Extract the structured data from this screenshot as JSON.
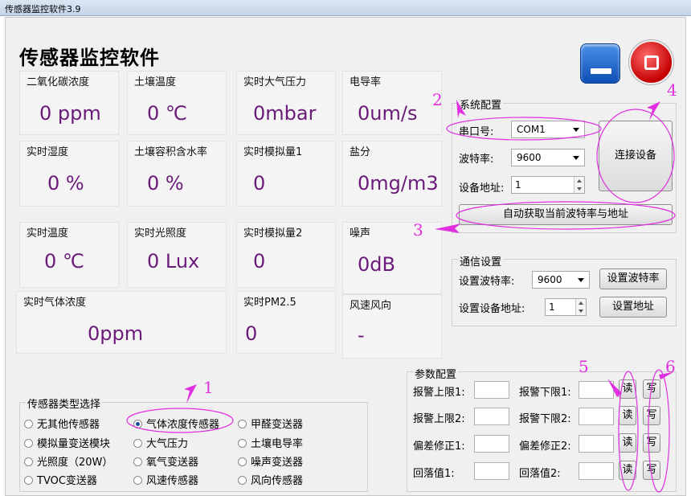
{
  "window": {
    "title": "传感器监控软件3.9"
  },
  "app_title": "传感器监控软件",
  "tiles": [
    {
      "label": "二氧化碳浓度",
      "value": "0 ppm"
    },
    {
      "label": "土壤温度",
      "value": "0 ℃"
    },
    {
      "label": "实时大气压力",
      "value": "0mbar"
    },
    {
      "label": "电导率",
      "value": "0um/s"
    },
    {
      "label": "实时湿度",
      "value": "0 %"
    },
    {
      "label": "土壤容积含水率",
      "value": "0 %"
    },
    {
      "label": "实时模拟量1",
      "value": "0"
    },
    {
      "label": "盐分",
      "value": "0mg/m3"
    },
    {
      "label": "实时温度",
      "value": "0 ℃"
    },
    {
      "label": "实时光照度",
      "value": "0 Lux"
    },
    {
      "label": "实时模拟量2",
      "value": "0"
    },
    {
      "label": "噪声",
      "value": "0dB"
    },
    {
      "label": "实时气体浓度",
      "value": "0ppm"
    },
    {
      "label": "实时PM2.5",
      "value": "0"
    },
    {
      "label": "风速风向",
      "value": "-"
    }
  ],
  "system_config": {
    "title": "系统配置",
    "port_label": "串口号:",
    "port_value": "COM1",
    "baud_label": "波特率:",
    "baud_value": "9600",
    "addr_label": "设备地址:",
    "addr_value": "1",
    "connect_button": "连接设备",
    "auto_button": "自动获取当前波特率与地址"
  },
  "comm_config": {
    "title": "通信设置",
    "baud_label": "设置波特率:",
    "baud_value": "9600",
    "baud_button": "设置波特率",
    "addr_label": "设置设备地址:",
    "addr_value": "1",
    "addr_button": "设置地址"
  },
  "param_config": {
    "title": "参数配置",
    "rows": [
      {
        "left_label": "报警上限1:",
        "right_label": "报警下限1:"
      },
      {
        "left_label": "报警上限2:",
        "right_label": "报警下限2:"
      },
      {
        "left_label": "偏差修正1:",
        "right_label": "偏差修正2:"
      },
      {
        "left_label": "回落值1:",
        "right_label": "回落值2:"
      }
    ],
    "read_label": "读",
    "write_label": "写"
  },
  "sensor_type": {
    "title": "传感器类型选择",
    "options": [
      {
        "label": "无其他传感器",
        "selected": false
      },
      {
        "label": "气体浓度传感器",
        "selected": true
      },
      {
        "label": "甲醛变送器",
        "selected": false
      },
      {
        "label": "模拟量变送模块",
        "selected": false
      },
      {
        "label": "大气压力",
        "selected": false
      },
      {
        "label": "土壤电导率",
        "selected": false
      },
      {
        "label": "光照度（20W）",
        "selected": false
      },
      {
        "label": "氧气变送器",
        "selected": false
      },
      {
        "label": "噪声变送器",
        "selected": false
      },
      {
        "label": "TVOC变送器",
        "selected": false
      },
      {
        "label": "风速传感器",
        "selected": false
      },
      {
        "label": "风向传感器",
        "selected": false
      }
    ]
  },
  "annotations": [
    "1",
    "2",
    "3",
    "4",
    "5",
    "6"
  ],
  "colors": {
    "value_text": "#6b1a7a",
    "annotation": "#e030e0"
  }
}
